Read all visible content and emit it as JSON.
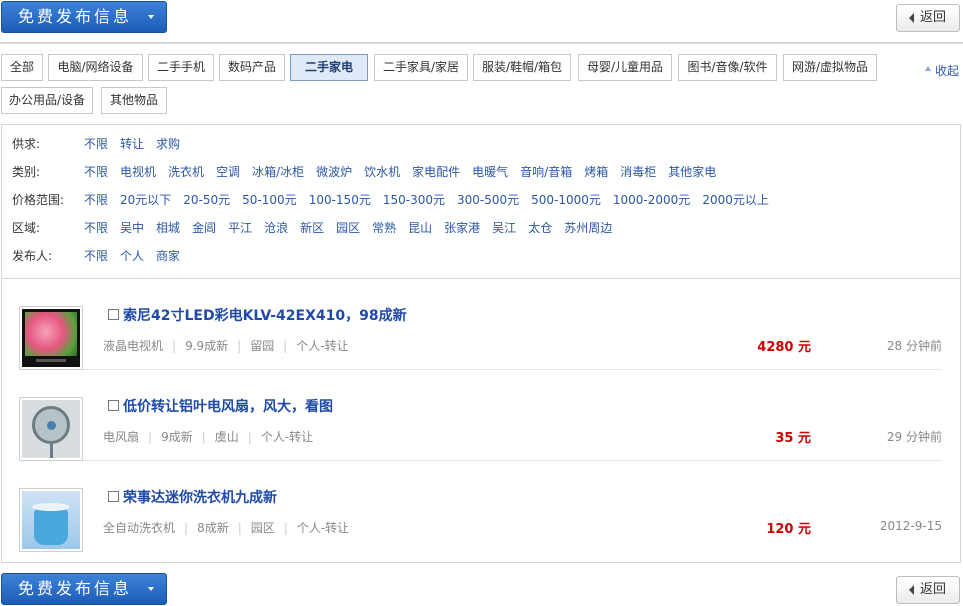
{
  "toolbar": {
    "post_label": "免费发布信息",
    "back_label": "返回"
  },
  "categories": [
    {
      "label": "全部",
      "active": false
    },
    {
      "label": "电脑/网络设备",
      "active": false
    },
    {
      "label": "二手手机",
      "active": false
    },
    {
      "label": "数码产品",
      "active": false
    },
    {
      "label": "二手家电",
      "active": true
    },
    {
      "label": "二手家具/家居",
      "active": false
    },
    {
      "label": "服装/鞋帽/箱包",
      "active": false
    },
    {
      "label": "母婴/儿童用品",
      "active": false
    },
    {
      "label": "图书/音像/软件",
      "active": false
    },
    {
      "label": "网游/虚拟物品",
      "active": false
    },
    {
      "label": "办公用品/设备",
      "active": false
    },
    {
      "label": "其他物品",
      "active": false
    }
  ],
  "collapse_label": "收起",
  "filters": [
    {
      "label": "供求:",
      "options": [
        "不限",
        "转让",
        "求购"
      ]
    },
    {
      "label": "类别:",
      "options": [
        "不限",
        "电视机",
        "洗衣机",
        "空调",
        "冰箱/冰柜",
        "微波炉",
        "饮水机",
        "家电配件",
        "电暖气",
        "音响/音箱",
        "烤箱",
        "消毒柜",
        "其他家电"
      ]
    },
    {
      "label": "价格范围:",
      "options": [
        "不限",
        "20元以下",
        "20-50元",
        "50-100元",
        "100-150元",
        "150-300元",
        "300-500元",
        "500-1000元",
        "1000-2000元",
        "2000元以上"
      ]
    },
    {
      "label": "区域:",
      "options": [
        "不限",
        "吴中",
        "相城",
        "金阊",
        "平江",
        "沧浪",
        "新区",
        "园区",
        "常熟",
        "昆山",
        "张家港",
        "吴江",
        "太仓",
        "苏州周边"
      ]
    },
    {
      "label": "发布人:",
      "options": [
        "不限",
        "个人",
        "商家"
      ]
    }
  ],
  "listings": [
    {
      "title": "索尼42寸LED彩电KLV-42EX410，98成新",
      "category": "液晶电视机",
      "condition": "9.9成新",
      "location": "留园",
      "poster": "个人-转让",
      "price": "4280 元",
      "time": "28 分钟前",
      "thumb": "tv"
    },
    {
      "title": "低价转让铝叶电风扇，风大，看图",
      "category": "电风扇",
      "condition": "9成新",
      "location": "虞山",
      "poster": "个人-转让",
      "price": "35 元",
      "time": "29 分钟前",
      "thumb": "fan"
    },
    {
      "title": "荣事达迷你洗衣机九成新",
      "category": "全自动洗衣机",
      "condition": "8成新",
      "location": "园区",
      "poster": "个人-转让",
      "price": "120 元",
      "time": "2012-9-15",
      "thumb": "washer"
    }
  ]
}
